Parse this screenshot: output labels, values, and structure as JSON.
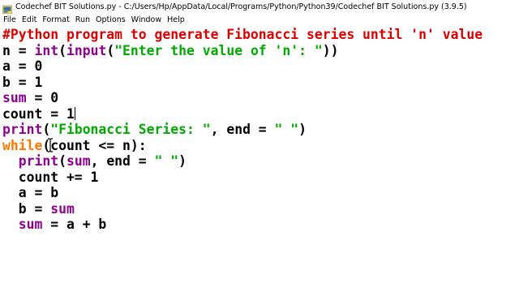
{
  "window": {
    "title": "Codechef BIT Solutions.py - C:/Users/Hp/AppData/Local/Programs/Python/Python39/Codechef BIT Solutions.py (3.9.5)"
  },
  "menu": {
    "items": [
      "File",
      "Edit",
      "Format",
      "Run",
      "Options",
      "Window",
      "Help"
    ]
  },
  "editor": {
    "lines": [
      {
        "tokens": [
          {
            "t": "comment",
            "v": "#Python program to generate Fibonacci series until 'n' value"
          }
        ]
      },
      {
        "tokens": [
          {
            "t": "plain",
            "v": "n = "
          },
          {
            "t": "builtin",
            "v": "int"
          },
          {
            "t": "plain",
            "v": "("
          },
          {
            "t": "builtin",
            "v": "input"
          },
          {
            "t": "plain",
            "v": "("
          },
          {
            "t": "string",
            "v": "\"Enter the value of 'n': \""
          },
          {
            "t": "plain",
            "v": "))"
          }
        ]
      },
      {
        "tokens": [
          {
            "t": "plain",
            "v": "a = 0"
          }
        ]
      },
      {
        "tokens": [
          {
            "t": "plain",
            "v": "b = 1"
          }
        ]
      },
      {
        "tokens": [
          {
            "t": "builtin",
            "v": "sum"
          },
          {
            "t": "plain",
            "v": " = 0"
          }
        ]
      },
      {
        "tokens": [
          {
            "t": "plain",
            "v": "count = 1"
          },
          {
            "t": "caret",
            "v": ""
          }
        ]
      },
      {
        "tokens": [
          {
            "t": "builtin",
            "v": "print"
          },
          {
            "t": "plain",
            "v": "("
          },
          {
            "t": "string",
            "v": "\"Fibonacci Series: \""
          },
          {
            "t": "plain",
            "v": ", end = "
          },
          {
            "t": "string",
            "v": "\" \""
          },
          {
            "t": "plain",
            "v": ")"
          }
        ]
      },
      {
        "tokens": [
          {
            "t": "kw",
            "v": "while"
          },
          {
            "t": "plain",
            "v": "(count <= n):"
          }
        ]
      },
      {
        "tokens": [
          {
            "t": "plain",
            "v": "  "
          },
          {
            "t": "builtin",
            "v": "print"
          },
          {
            "t": "plain",
            "v": "("
          },
          {
            "t": "builtin",
            "v": "sum"
          },
          {
            "t": "plain",
            "v": ", end = "
          },
          {
            "t": "string",
            "v": "\" \""
          },
          {
            "t": "plain",
            "v": ")"
          }
        ]
      },
      {
        "tokens": [
          {
            "t": "plain",
            "v": "  count += 1"
          }
        ]
      },
      {
        "tokens": [
          {
            "t": "plain",
            "v": "  a = b"
          }
        ]
      },
      {
        "tokens": [
          {
            "t": "plain",
            "v": "  b = "
          },
          {
            "t": "builtin",
            "v": "sum"
          }
        ]
      },
      {
        "tokens": [
          {
            "t": "plain",
            "v": "  "
          },
          {
            "t": "builtin",
            "v": "sum"
          },
          {
            "t": "plain",
            "v": " = a + b"
          }
        ]
      }
    ]
  },
  "icons": {
    "app": "python-idle-icon",
    "pointer": "text-cursor-icon"
  },
  "colors": {
    "comment": "#dd0000",
    "keyword": "#ff7700",
    "builtin": "#900090",
    "string": "#00aa00",
    "text": "#000000",
    "background": "#ffffff"
  }
}
